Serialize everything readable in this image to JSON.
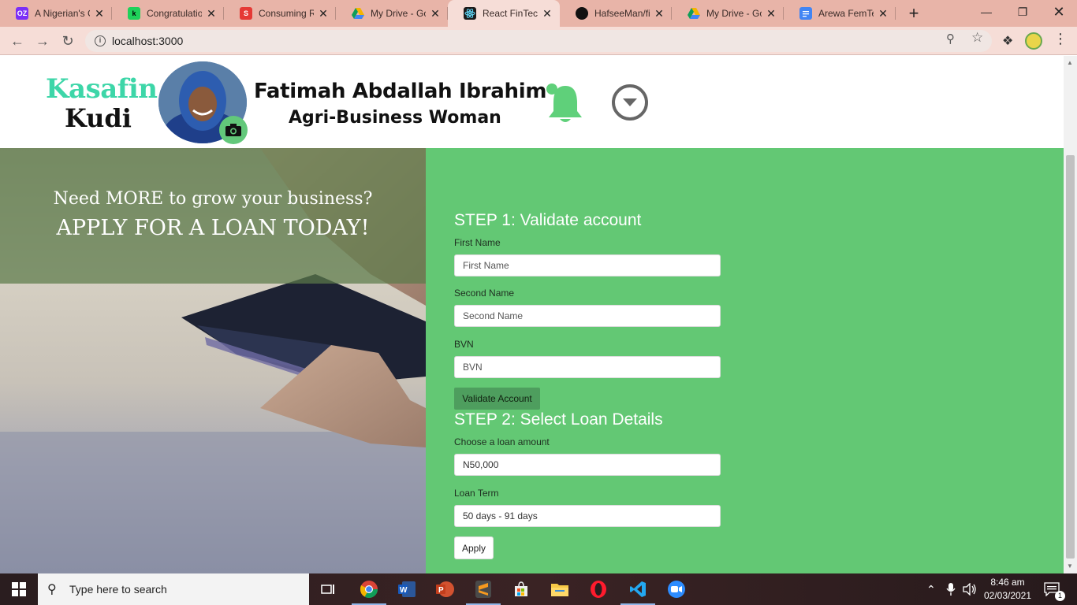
{
  "browser": {
    "tabs": [
      {
        "label": "A Nigerian's G",
        "favicon": "OZ",
        "color": "#7b2ff7"
      },
      {
        "label": "Congratulation",
        "favicon": "k",
        "color": "#1fd15a"
      },
      {
        "label": "Consuming RE",
        "favicon": "S",
        "color": "#e53935"
      },
      {
        "label": "My Drive - Go",
        "favicon": "drive",
        "color": "#f4b400"
      },
      {
        "label": "React FinTech",
        "favicon": "react",
        "color": "#1b1b1b",
        "active": true
      },
      {
        "label": "HafseeMan/fin",
        "favicon": "github",
        "color": "#111111"
      },
      {
        "label": "My Drive - Goo",
        "favicon": "drive",
        "color": "#f4b400"
      },
      {
        "label": "Arewa FemTec",
        "favicon": "docs",
        "color": "#4285f4"
      }
    ],
    "url": "localhost:3000"
  },
  "header": {
    "brand_line1": "Kasafin",
    "brand_line2": "Kudi",
    "user_name": "Fatimah Abdallah Ibrahim",
    "user_role": "Agri-Business Woman"
  },
  "hero": {
    "line1": "Need MORE to grow your business?",
    "line2": "APPLY FOR A LOAN TODAY!"
  },
  "form": {
    "step1_title": "STEP 1: Validate account",
    "first_name_label": "First Name",
    "first_name_placeholder": "First Name",
    "second_name_label": "Second Name",
    "second_name_placeholder": "Second Name",
    "bvn_label": "BVN",
    "bvn_placeholder": "BVN",
    "validate_button": "Validate Account",
    "step2_title": "STEP 2: Select Loan Details",
    "amount_label": "Choose a loan amount",
    "amount_value": "N50,000",
    "term_label": "Loan Term",
    "term_value": "50 days - 91 days",
    "apply_button": "Apply"
  },
  "taskbar": {
    "search_placeholder": "Type here to search",
    "time": "8:46 am",
    "date": "02/03/2021",
    "notification_count": "1"
  },
  "colors": {
    "brand_green": "#3dd6a8",
    "form_bg": "#63c874",
    "validate_btn": "#4e9e5e",
    "bell_green": "#5fd07a"
  }
}
